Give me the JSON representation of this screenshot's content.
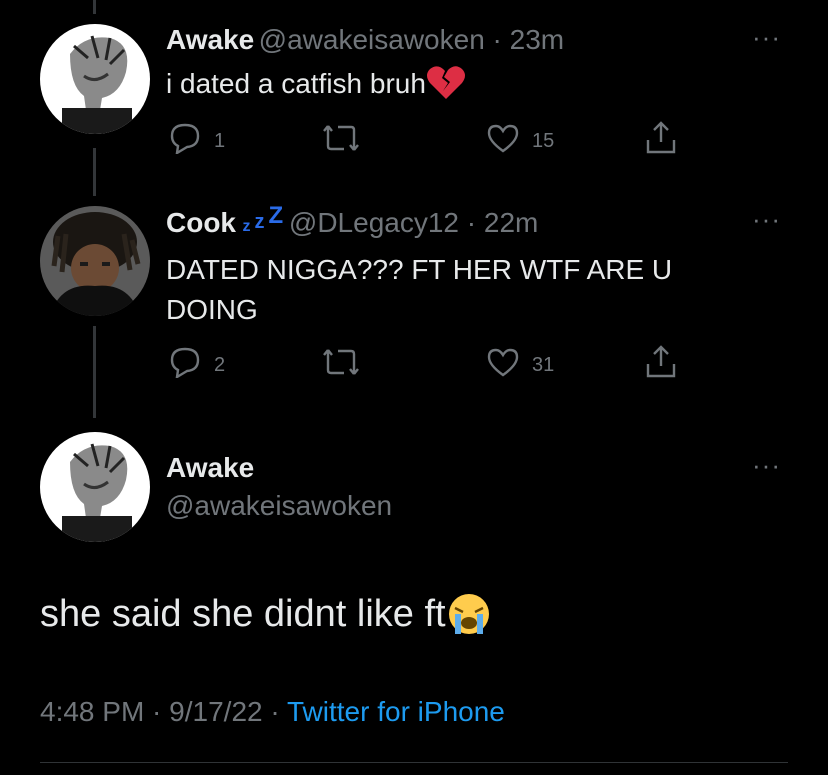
{
  "tweets": [
    {
      "name": "Awake",
      "handle": "@awakeisawoken",
      "sep": " · ",
      "time": "23m",
      "text": "i dated a catfish bruh",
      "emoji": "broken-heart",
      "replies": "1",
      "likes": "15"
    },
    {
      "name": "Cook",
      "name_emoji": "zzz",
      "handle": "@DLegacy12",
      "sep": " · ",
      "time": "22m",
      "text_line1": "DATED NIGGA??? FT HER WTF ARE U",
      "text_line2": "DOING",
      "replies": "2",
      "likes": "31"
    }
  ],
  "main": {
    "name": "Awake",
    "handle": "@awakeisawoken",
    "text": "she said she didnt like ft",
    "emoji": "crying-face",
    "time": "4:48 PM",
    "sep1": " · ",
    "date": "9/17/22",
    "sep2": " · ",
    "source": "Twitter for iPhone"
  },
  "colors": {
    "background": "#000000",
    "text": "#e7e9ea",
    "muted": "#71767b",
    "link": "#1d9bf0"
  }
}
